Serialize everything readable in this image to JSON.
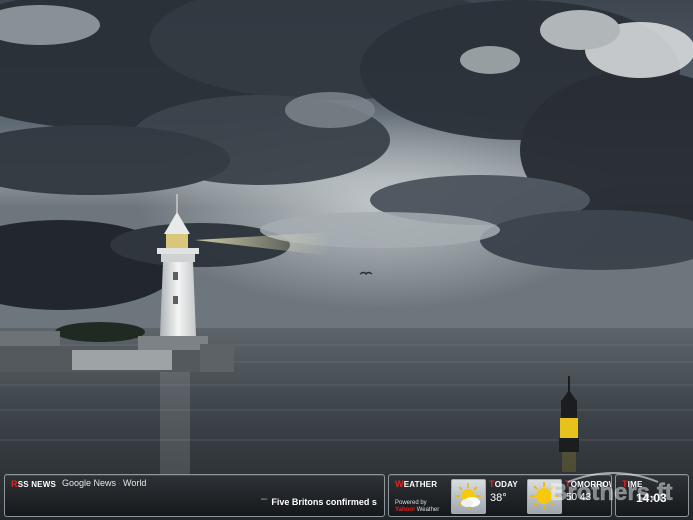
{
  "rss": {
    "title_first": "R",
    "title_rest": "SS NEWS",
    "feed_name": "Google News",
    "feed_separator": "·",
    "feed_section": "World",
    "ticker_marker": "\"\"\"",
    "ticker_text": "Five Britons confirmed s"
  },
  "weather": {
    "title_first": "W",
    "title_rest": "EATHER",
    "powered_line1": "Powered by",
    "powered_logo": "Yahoo!",
    "powered_line2": "Weather",
    "today_first": "T",
    "today_rest": "ODAY",
    "today_temp": "38°",
    "today_icon": "partly-cloudy-icon",
    "tomorrow_first": "T",
    "tomorrow_rest": "OMORROW",
    "tomorrow_temp": "50  43",
    "tomorrow_icon": "sunny-icon"
  },
  "time": {
    "title_first": "T",
    "title_rest": "IME",
    "clock": "14:03"
  },
  "watermark": {
    "text": "Brothers.ft"
  },
  "colors": {
    "accent_red": "#e2241b",
    "panel_dark": "#1c2024",
    "buoy_yellow": "#e8c21c"
  }
}
